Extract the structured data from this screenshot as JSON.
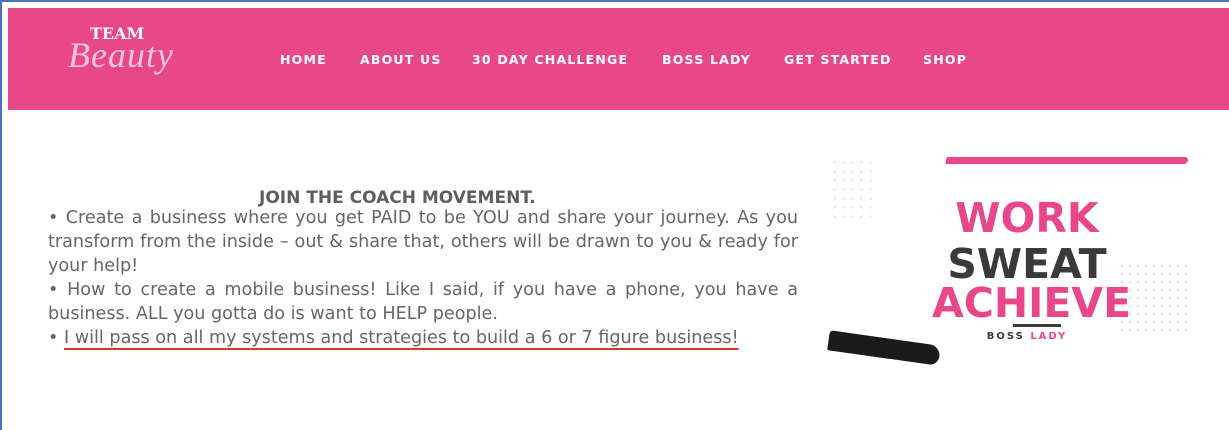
{
  "brand": {
    "logo_top": "TEAM",
    "logo_script": "Beauty"
  },
  "nav": {
    "items": [
      {
        "label": "HOME"
      },
      {
        "label": "ABOUT US"
      },
      {
        "label": "30 DAY CHALLENGE"
      },
      {
        "label": "BOSS LADY"
      },
      {
        "label": "GET STARTED"
      },
      {
        "label": "SHOP"
      }
    ]
  },
  "content": {
    "heading": "JOIN THE COACH MOVEMENT.",
    "bullet_symbol": "•",
    "bullets": [
      "Create a business where you get PAID to be YOU and share your journey. As you transform from the inside – out & share that, others will be drawn to you & ready for your help!",
      "How to create a mobile business! Like I said, if you have a phone, you have a business. ALL you gotta do is want to HELP people.",
      "I will pass on all my systems and strategies to build a 6 or 7 figure business!"
    ]
  },
  "promo": {
    "line1": "WORK",
    "line2": "SWEAT",
    "line3": "ACHIEVE",
    "tag_boss": "BOSS",
    "tag_lady": "LADY"
  },
  "colors": {
    "brand_pink": "#e8488a",
    "text_gray": "#666666",
    "underline_red": "#d23a2e",
    "promo_dark": "#3a3a3a"
  }
}
